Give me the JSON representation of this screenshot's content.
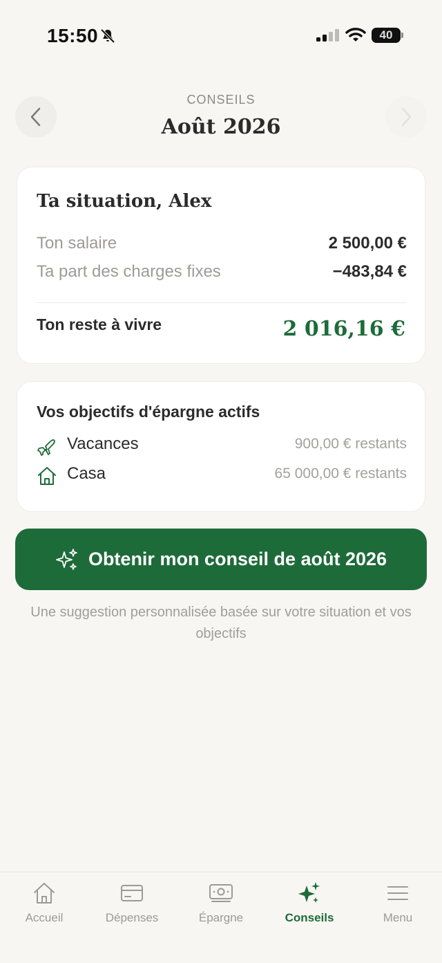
{
  "status_bar": {
    "time": "15:50",
    "battery_level": "40"
  },
  "header": {
    "eyebrow": "CONSEILS",
    "title": "Août 2026"
  },
  "situation": {
    "title": "Ta situation, Alex",
    "rows": [
      {
        "label": "Ton salaire",
        "value": "2 500,00 €"
      },
      {
        "label": "Ta part des charges fixes",
        "value": "−483,84 €"
      }
    ],
    "remain_label": "Ton reste à vivre",
    "remain_value": "2 016,16 €"
  },
  "goals": {
    "title": "Vos objectifs d'épargne actifs",
    "items": [
      {
        "icon": "plane-icon",
        "name": "Vacances",
        "remaining": "900,00 € restants"
      },
      {
        "icon": "house-icon",
        "name": "Casa",
        "remaining": "65 000,00 € restants"
      }
    ]
  },
  "cta": {
    "label": "Obtenir mon conseil de août 2026",
    "caption": "Une suggestion personnalisée basée sur votre situation et vos objectifs"
  },
  "tabs": [
    {
      "label": "Accueil",
      "icon": "home-icon",
      "active": false
    },
    {
      "label": "Dépenses",
      "icon": "card-icon",
      "active": false
    },
    {
      "label": "Épargne",
      "icon": "banknote-icon",
      "active": false
    },
    {
      "label": "Conseils",
      "icon": "sparkles-icon",
      "active": true
    },
    {
      "label": "Menu",
      "icon": "menu-icon",
      "active": false
    }
  ],
  "colors": {
    "accent": "#1e6b3a",
    "background": "#f7f6f2",
    "muted_text": "#9c9b97"
  }
}
